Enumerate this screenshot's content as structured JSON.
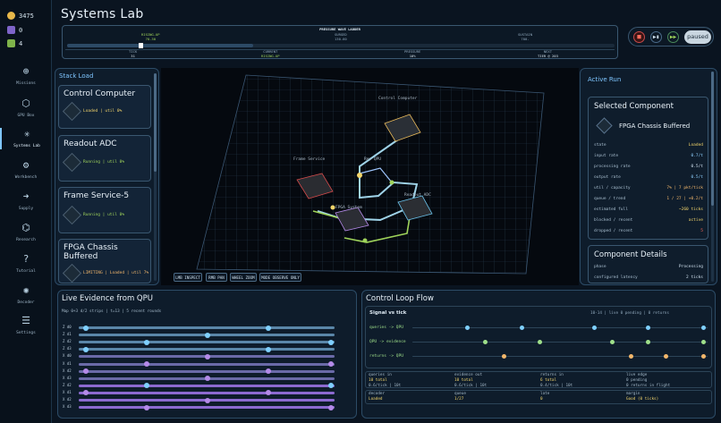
{
  "app_title": "Systems Lab",
  "resources": [
    {
      "icon": "coin-icon",
      "value": "3475",
      "color": "#e8b84a"
    },
    {
      "icon": "chip-icon",
      "value": "0",
      "color": "#a98be8"
    },
    {
      "icon": "battery-icon",
      "value": "4",
      "color": "#9ad35a"
    }
  ],
  "nav": [
    {
      "icon": "missions-icon",
      "label": "Missions"
    },
    {
      "icon": "gpu-box-icon",
      "label": "GPU Box"
    },
    {
      "icon": "systems-lab-icon",
      "label": "Systems Lab",
      "active": true
    },
    {
      "icon": "workbench-icon",
      "label": "Workbench"
    },
    {
      "icon": "supply-icon",
      "label": "Supply"
    },
    {
      "icon": "research-icon",
      "label": "Research"
    },
    {
      "icon": "tutorial-icon",
      "label": "Tutorial"
    },
    {
      "icon": "decoder-icon",
      "label": "Decoder"
    },
    {
      "icon": "settings-icon",
      "label": "Settings"
    }
  ],
  "ladder": {
    "title": "PRESSURE WAVE LADDER",
    "stages": [
      {
        "name": "RISING-UP",
        "range": "70-30"
      },
      {
        "name": "SURGED",
        "range": "130-60"
      },
      {
        "name": "SUSTAIN",
        "range": "700-"
      }
    ],
    "cols": [
      {
        "label": "TICK",
        "value": "31"
      },
      {
        "label": "CURRENT",
        "value": "RISING-UP",
        "accent": true
      },
      {
        "label": "PRESSURE",
        "value": "10%"
      },
      {
        "label": "NEXT",
        "value": "TIER @ 203"
      }
    ],
    "progress": 0.42
  },
  "controls": {
    "state_label": "paused"
  },
  "stack_load": {
    "title": "Stack Load",
    "items": [
      {
        "name": "Control Computer",
        "status": "Loaded | util 0%"
      },
      {
        "name": "Readout ADC",
        "status": "Running | util 0%"
      },
      {
        "name": "Frame Service-5",
        "status": "Running | util 0%"
      },
      {
        "name": "FPGA Chassis Buffered",
        "status": "LIMITING | Loaded | util 7%"
      }
    ]
  },
  "map": {
    "nodes": [
      "Control Computer",
      "Frame Service",
      "Rep QPU",
      "Readout ADC",
      "FPGA System"
    ],
    "buttons": [
      "LMB INSPECT",
      "RMB PAN",
      "WHEEL ZOOM",
      "MODE OBSERVE ONLY"
    ]
  },
  "active_run": {
    "title": "Active Run",
    "selected_title": "Selected Component",
    "component_name": "FPGA Chassis Buffered",
    "rows": [
      {
        "k": "state",
        "v": "Loaded",
        "c": "#f3d56b"
      },
      {
        "k": "input rate",
        "v": "0.7/t",
        "c": "#8fd0ff"
      },
      {
        "k": "processing rate",
        "v": "0.5/t",
        "c": "#cfe0ee"
      },
      {
        "k": "output rate",
        "v": "0.5/t",
        "c": "#8fd0ff"
      },
      {
        "k": "util / capacity",
        "v": "7% | 7 pkt/tick",
        "c": "#f3b76b"
      },
      {
        "k": "queue / trend",
        "v": "1 / 27 | +0.2/t",
        "c": "#f3b76b"
      },
      {
        "k": "estimated full",
        "v": "~260 ticks",
        "c": "#f3d56b"
      },
      {
        "k": "blocked / recent",
        "v": "active",
        "c": "#f3d56b"
      },
      {
        "k": "dropped / recent",
        "v": "5",
        "c": "#ff6b5b"
      }
    ],
    "details_title": "Component Details",
    "details": [
      {
        "k": "phase",
        "v": "Processing"
      },
      {
        "k": "configured latency",
        "v": "2 ticks"
      }
    ]
  },
  "evidence": {
    "title": "Live Evidence from QPU",
    "subtitle": "Map 0+3 d/2 strips | t=13 | 5 recent rounds",
    "rows": [
      "Z d0",
      "Z d1",
      "Z d2",
      "Z d3",
      "X d0",
      "X d1",
      "X d2",
      "X d3",
      "Z d2",
      "X d1",
      "X d2",
      "X d3"
    ]
  },
  "control_loop": {
    "title": "Control Loop Flow",
    "signal_title": "Signal vs tick",
    "signal_meta": "10-14 | live 0 pending | 0 returns",
    "signals": [
      "queries -> QPU",
      "QPU -> evidence",
      "returns -> QPU"
    ],
    "stats_top": [
      {
        "k": "queries in",
        "v": "10 total",
        "s": "0.6/tick | 10t"
      },
      {
        "k": "evidence out",
        "v": "10 total",
        "s": "0.6/tick | 10t"
      },
      {
        "k": "returns in",
        "v": "6 total",
        "s": "0.4/tick | 10t"
      },
      {
        "k": "live edge",
        "v": "0 pending",
        "s": "0 returns in flight"
      }
    ],
    "stats_bottom": [
      {
        "k": "decoder",
        "v": "Loaded"
      },
      {
        "k": "queue",
        "v": "1/27"
      },
      {
        "k": "late",
        "v": "0"
      },
      {
        "k": "margin",
        "v": "Good (0 ticks)"
      }
    ]
  }
}
